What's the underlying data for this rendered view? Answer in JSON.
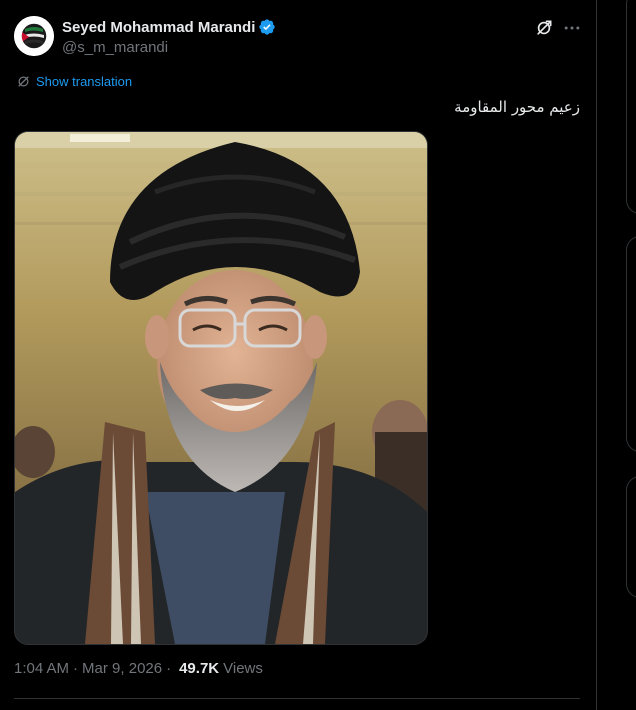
{
  "author": {
    "display_name": "Seyed Mohammad Marandi",
    "handle": "@s_m_marandi",
    "verified": true,
    "avatar_icon": "palestine-flag-avatar-icon"
  },
  "translation": {
    "label": "Show translation"
  },
  "tweet": {
    "text": "زعيم محور المقاومة"
  },
  "media": {
    "alt": "photo"
  },
  "meta": {
    "time": "1:04 AM",
    "separator": "·",
    "date": "Mar 9, 2026",
    "separator2": "·",
    "views_count": "49.7K",
    "views_label": "Views"
  },
  "colors": {
    "background": "#000000",
    "text": "#e7e9ea",
    "muted": "#71767b",
    "accent": "#1d9bf0",
    "border": "#2f3336"
  }
}
